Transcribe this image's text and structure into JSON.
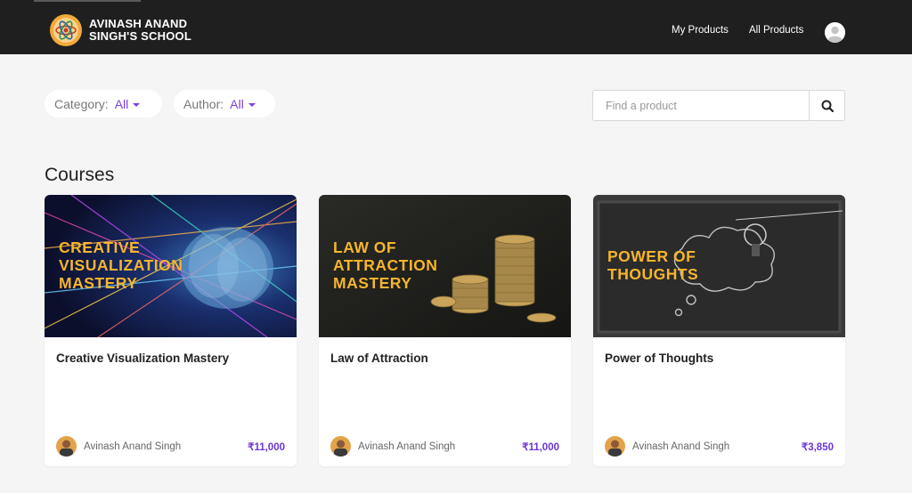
{
  "header": {
    "logo_line1": "AVINASH ANAND",
    "logo_line2": "SINGH'S SCHOOL",
    "nav": {
      "my_products": "My Products",
      "all_products": "All Products"
    }
  },
  "filters": {
    "category": {
      "label": "Category:",
      "value": "All"
    },
    "author": {
      "label": "Author:",
      "value": "All"
    }
  },
  "search": {
    "placeholder": "Find a product",
    "value": ""
  },
  "section_title": "Courses",
  "courses": [
    {
      "overlay": [
        "CREATIVE",
        "VISUALIZATION",
        "MASTERY"
      ],
      "title": "Creative Visualization Mastery",
      "author": "Avinash Anand Singh",
      "price": "₹11,000"
    },
    {
      "overlay": [
        "LAW OF",
        "ATTRACTION",
        "MASTERY"
      ],
      "title": "Law of Attraction",
      "author": "Avinash Anand Singh",
      "price": "₹11,000"
    },
    {
      "overlay": [
        "POWER OF",
        "THOUGHTS"
      ],
      "title": "Power of Thoughts",
      "author": "Avinash Anand Singh",
      "price": "₹3,850"
    }
  ],
  "colors": {
    "accent": "#7b3fe4",
    "price": "#6b34d8",
    "header_bg": "#1f1f1f",
    "overlay_text": "#f6b52c"
  }
}
